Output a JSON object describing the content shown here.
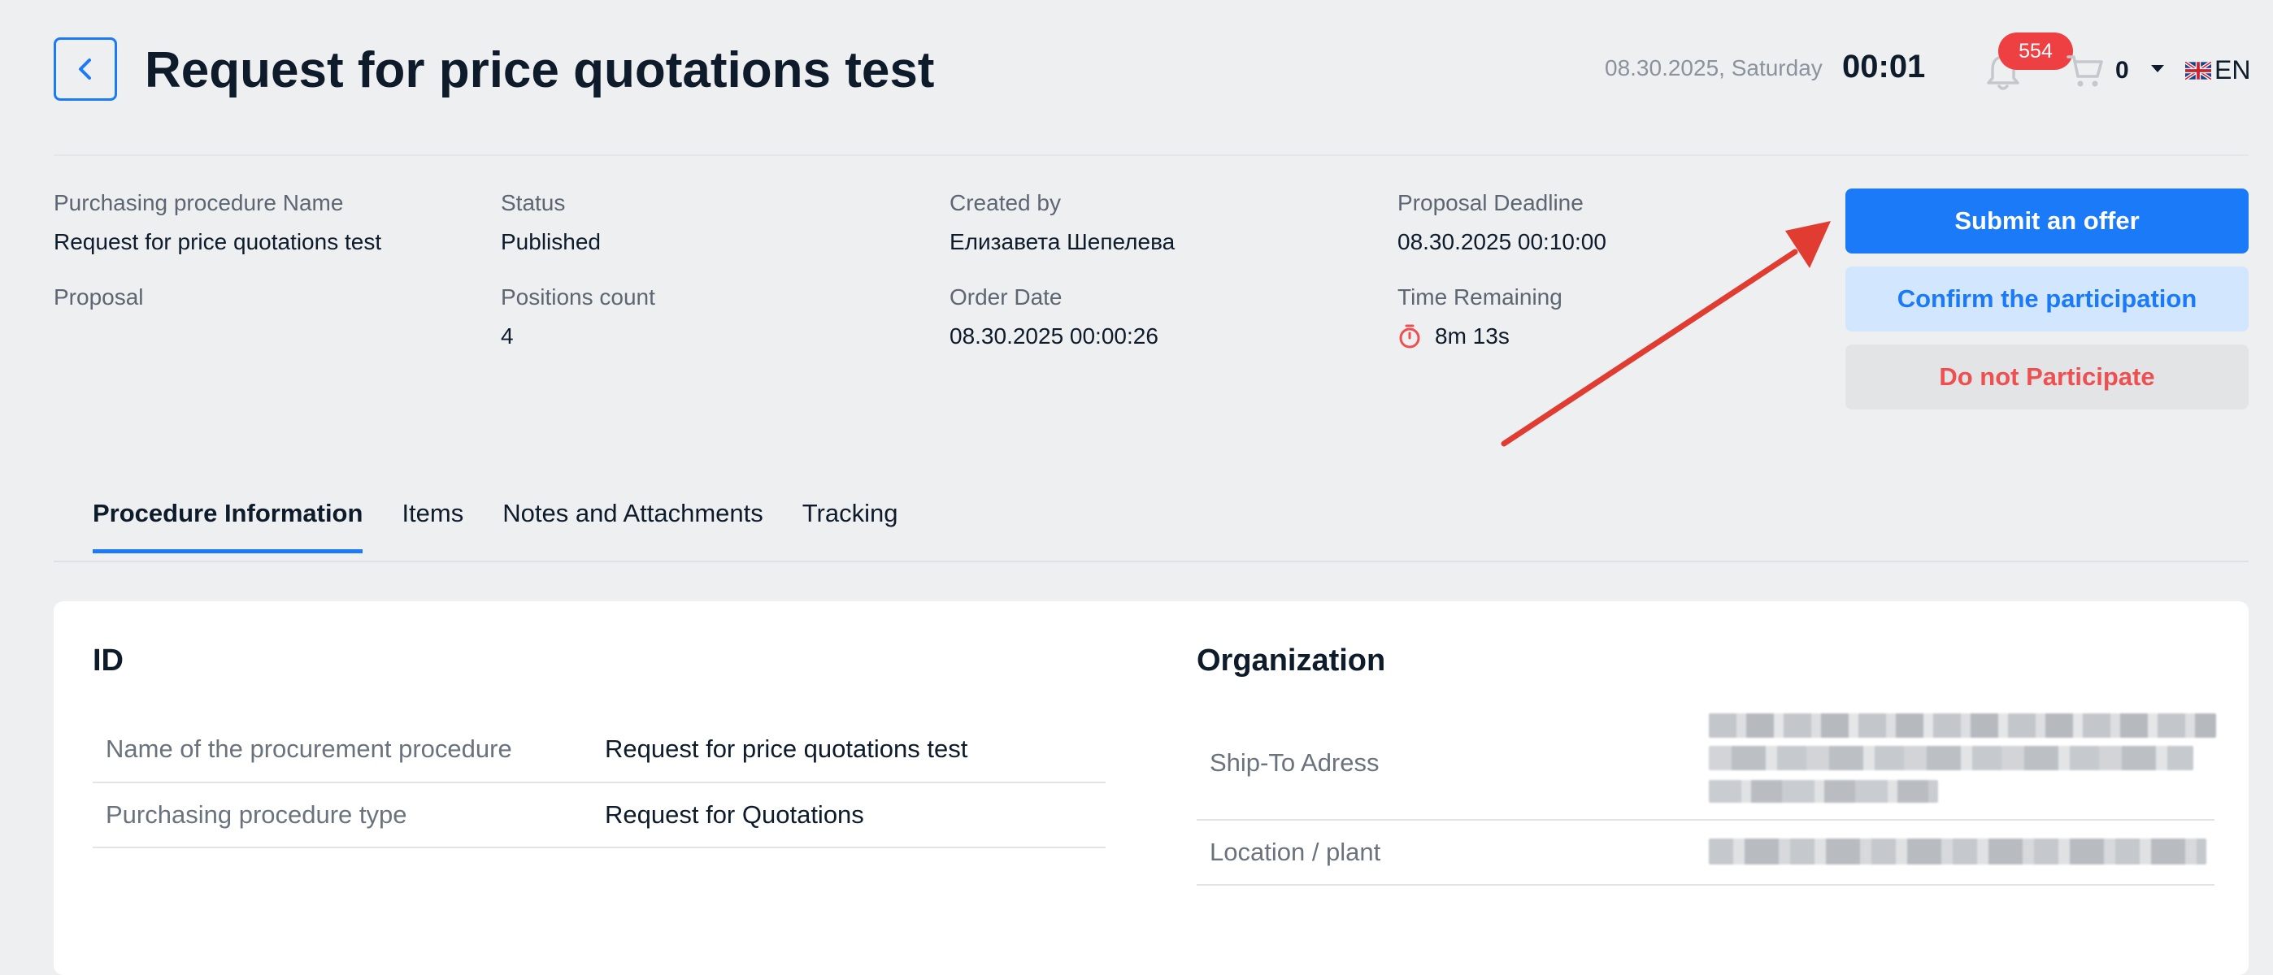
{
  "header": {
    "title": "Request for price quotations test",
    "date": "08.30.2025, Saturday",
    "time": "00:01",
    "notifications_count": "554",
    "cart_count": "0",
    "language": "EN"
  },
  "summary": {
    "procedure_name_label": "Purchasing procedure Name",
    "procedure_name_value": "Request for price quotations test",
    "status_label": "Status",
    "status_value": "Published",
    "created_by_label": "Created by",
    "created_by_value": "Елизавета Шепелева",
    "deadline_label": "Proposal Deadline",
    "deadline_value": "08.30.2025 00:10:00",
    "proposal_label": "Proposal",
    "positions_label": "Positions count",
    "positions_value": "4",
    "order_date_label": "Order Date",
    "order_date_value": "08.30.2025 00:00:26",
    "time_remaining_label": "Time Remaining",
    "time_remaining_value": "8m 13s"
  },
  "actions": {
    "submit": "Submit an offer",
    "confirm": "Confirm the participation",
    "decline": "Do not Participate"
  },
  "tabs": [
    {
      "label": "Procedure Information",
      "active": true
    },
    {
      "label": "Items",
      "active": false
    },
    {
      "label": "Notes and Attachments",
      "active": false
    },
    {
      "label": "Tracking",
      "active": false
    }
  ],
  "id_section": {
    "title": "ID",
    "rows": [
      {
        "label": "Name of the procurement procedure",
        "value": "Request for price quotations test"
      },
      {
        "label": "Purchasing procedure type",
        "value": "Request for Quotations"
      }
    ]
  },
  "organization_section": {
    "title": "Organization",
    "rows": [
      {
        "label": "Ship-To Adress"
      },
      {
        "label": "Location / plant"
      }
    ]
  },
  "colors": {
    "accent": "#1a7af8",
    "danger": "#ee4f51",
    "badge": "#ee3f42",
    "annotation_arrow": "#e03c31"
  }
}
